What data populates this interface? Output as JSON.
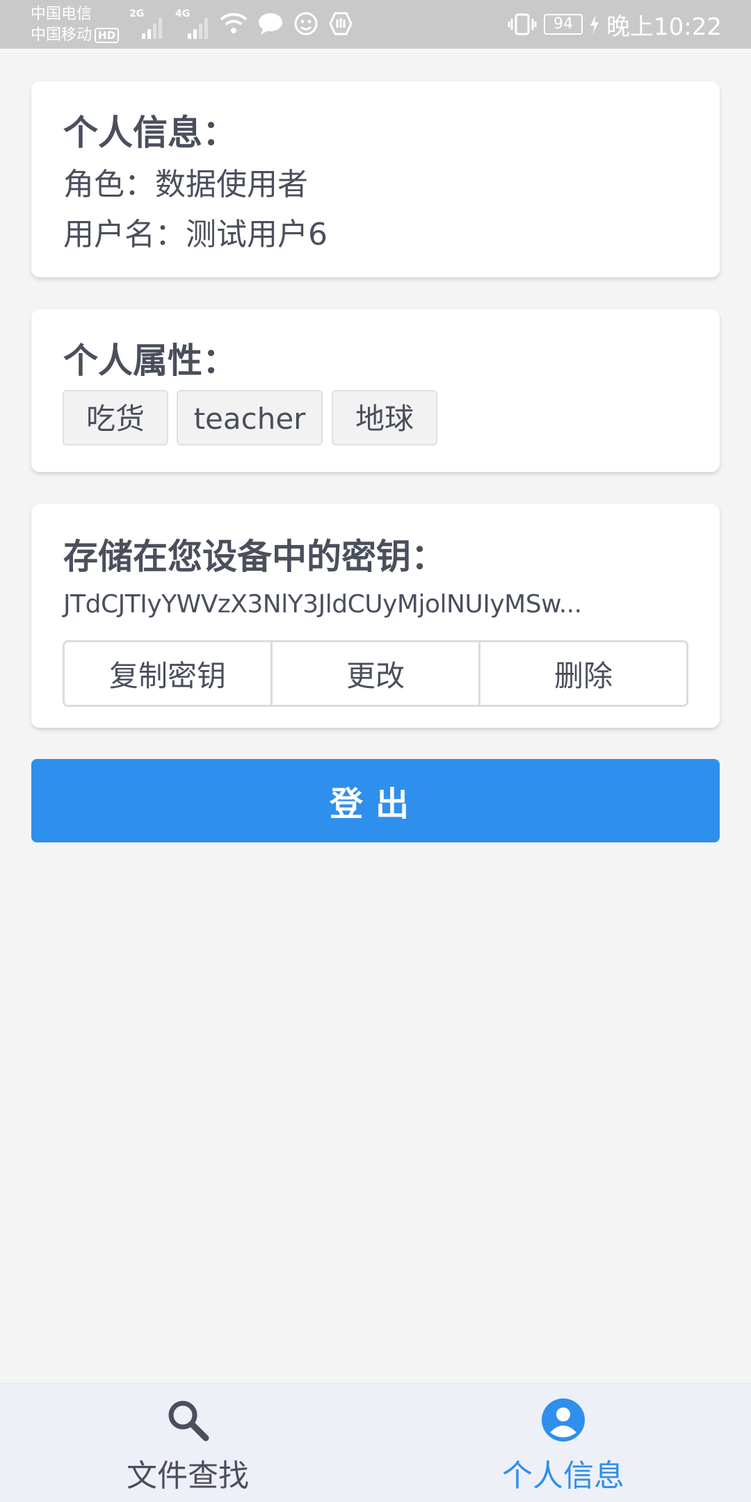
{
  "status_bar": {
    "carrier1": "中国电信",
    "carrier2": "中国移动",
    "hd": "HD",
    "net1": "2G",
    "net2": "4G",
    "battery": "94",
    "time": "晚上10:22"
  },
  "personal_info": {
    "title": "个人信息：",
    "role_line": "角色：数据使用者",
    "username_line": "用户名：测试用户6"
  },
  "personal_attributes": {
    "title": "个人属性：",
    "tags": [
      "吃货",
      "teacher",
      "地球"
    ]
  },
  "stored_key": {
    "title": "存储在您设备中的密钥：",
    "key": "JTdCJTIyYWVzX3NlY3JldCUyMjolNUIyMSw...",
    "buttons": [
      "复制密钥",
      "更改",
      "删除"
    ]
  },
  "logout_label": "登出",
  "tabbar": {
    "tabs": [
      {
        "label": "文件查找",
        "icon": "search-icon",
        "active": false
      },
      {
        "label": "个人信息",
        "icon": "user-circle-icon",
        "active": true
      }
    ]
  },
  "colors": {
    "primary": "#2f8fec",
    "text": "#4a4f5c",
    "background": "#f4f4f4",
    "status_bar": "#c9c9c9"
  }
}
